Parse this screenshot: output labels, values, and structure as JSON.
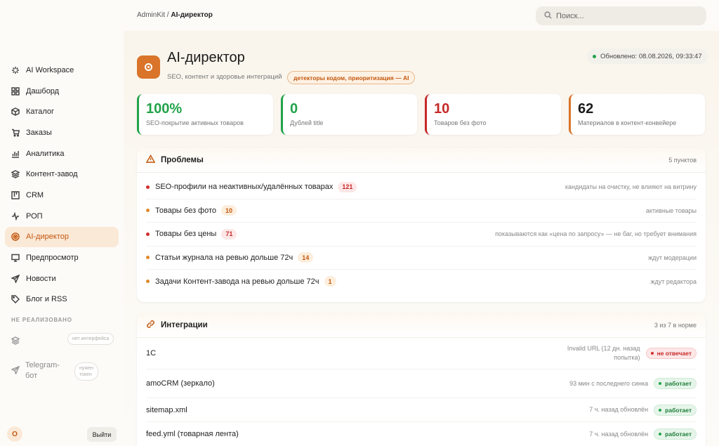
{
  "breadcrumb": {
    "root": "AdminKit",
    "separator": " / ",
    "current": "AI-директор"
  },
  "search": {
    "placeholder": "Поиск..."
  },
  "sidebar": {
    "items": [
      {
        "label": "AI Workspace",
        "icon": "sparkle-icon"
      },
      {
        "label": "Дашборд",
        "icon": "grid-icon"
      },
      {
        "label": "Каталог",
        "icon": "box-icon"
      },
      {
        "label": "Заказы",
        "icon": "cart-icon"
      },
      {
        "label": "Аналитика",
        "icon": "bar-chart-icon"
      },
      {
        "label": "Контент-завод",
        "icon": "layers-icon"
      },
      {
        "label": "CRM",
        "icon": "kanban-icon"
      },
      {
        "label": "РОП",
        "icon": "pulse-icon"
      },
      {
        "label": "AI-директор",
        "icon": "target-icon"
      },
      {
        "label": "Предпросмотр",
        "icon": "monitor-icon"
      },
      {
        "label": "Новости",
        "icon": "send-icon"
      },
      {
        "label": "Блог и RSS",
        "icon": "tag-icon"
      }
    ],
    "section_label": "НЕ РЕАЛИЗОВАНО",
    "not_implemented": [
      {
        "label": "",
        "pill": "нет интерфейса",
        "icon": "layers-icon"
      },
      {
        "label_line1": "Telegram-",
        "label_line2": "бот",
        "pill_line1": "нужен",
        "pill_line2": "токен",
        "icon": "send-icon"
      }
    ],
    "user_initial": "O",
    "logout_label": "Выйти"
  },
  "page": {
    "title": "AI-директор",
    "subtitle": "SEO, контент и здоровье интеграций",
    "ai_badge": "детекторы кодом, приоритизация — AI",
    "updated": "Обновлено: 08.08.2026, 09:33:47"
  },
  "kpis": [
    {
      "value": "100%",
      "label": "SEO-покрытие активных товаров",
      "color": "#22a34a"
    },
    {
      "value": "0",
      "label": "Дублей title",
      "color": "#22a34a"
    },
    {
      "value": "10",
      "label": "Товаров без фото",
      "color": "#c62828"
    },
    {
      "value": "62",
      "label": "Материалов в контент-конвейере",
      "color": "#d9742a"
    }
  ],
  "problems": {
    "title": "Проблемы",
    "count_label": "5 пунктов",
    "rows": [
      {
        "text": "SEO-профили на неактивных/удалённых товарах",
        "count": "121",
        "severity": "red",
        "note": "кандидаты на очистку, не влияют на витрину"
      },
      {
        "text": "Товары без фото",
        "count": "10",
        "severity": "orange",
        "note": "активные товары"
      },
      {
        "text": "Товары без цены",
        "count": "71",
        "severity": "red",
        "note": "показываются как «цена по запросу» — не баг, но требует внимания"
      },
      {
        "text": "Статьи журнала на ревью дольше 72ч",
        "count": "14",
        "severity": "orange",
        "note": "ждут модерации"
      },
      {
        "text": "Задачи Контент-завода на ревью дольше 72ч",
        "count": "1",
        "severity": "orange",
        "note": "ждут редактора"
      }
    ]
  },
  "integrations": {
    "title": "Интеграции",
    "count_label": "3 из 7 в норме",
    "rows": [
      {
        "name": "1C",
        "note": "Invalid URL (12 дн. назад попытка)",
        "status": "не отвечает",
        "state": "bad"
      },
      {
        "name": "amoCRM (зеркало)",
        "note": "93 мин с последнего синка",
        "status": "работает",
        "state": "ok"
      },
      {
        "name": "sitemap.xml",
        "note": "7 ч. назад обновлён",
        "status": "работает",
        "state": "ok"
      },
      {
        "name": "feed.yml (товарная лента)",
        "note": "7 ч. назад обновлён",
        "status": "работает",
        "state": "ok"
      }
    ]
  }
}
